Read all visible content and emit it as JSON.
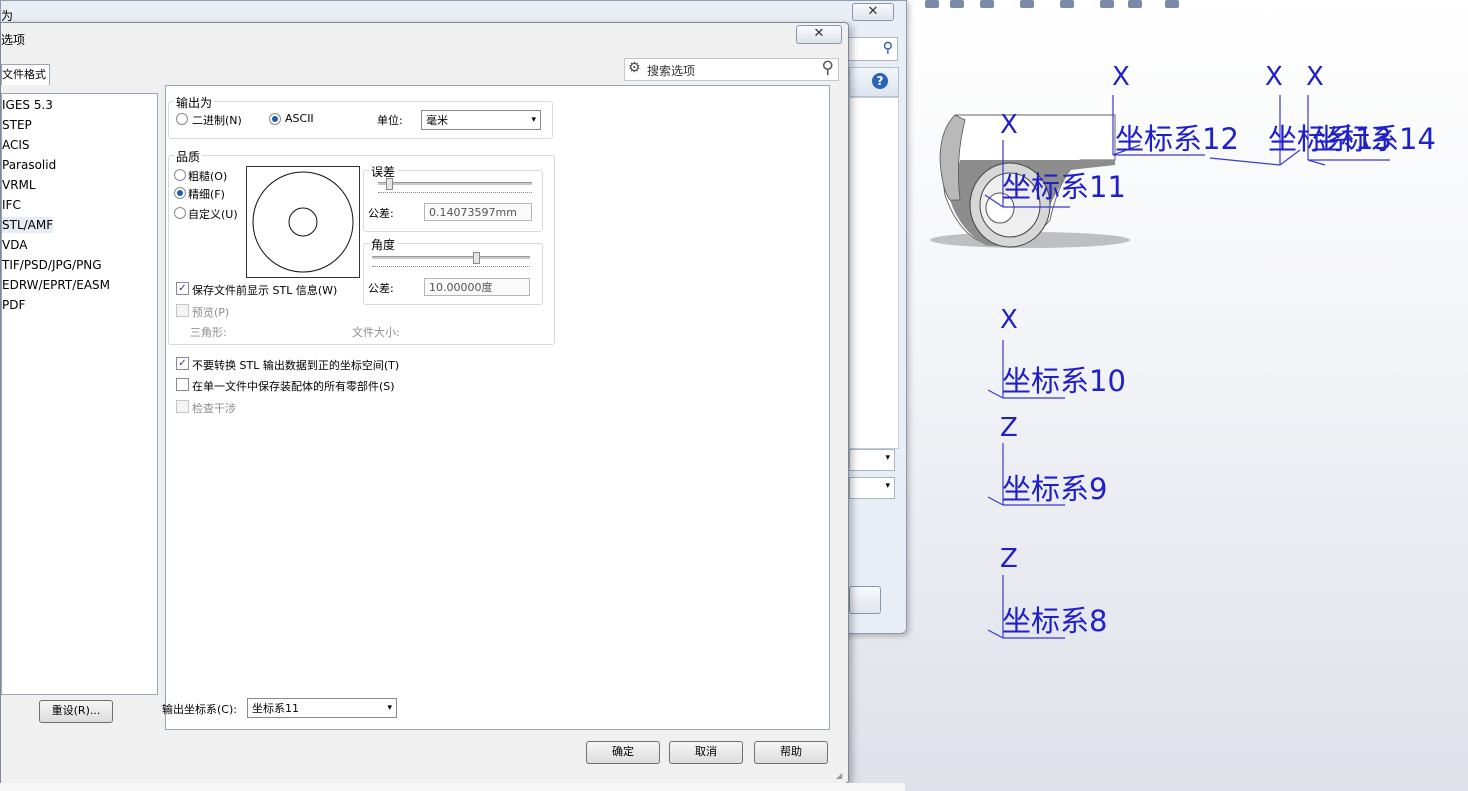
{
  "saveas_window": {
    "title": "为",
    "close_glyph": "✕",
    "search_glyph": "⚲",
    "help_glyph": "?",
    "combo_glyph": "▾"
  },
  "dialog": {
    "title": "选项",
    "close_glyph": "✕",
    "tab_label": "文件格式",
    "search_placeholder": "搜索选项",
    "search_glyph": "⚲",
    "gear_glyph": "⚙",
    "formats": [
      "IGES 5.3",
      "STEP",
      "ACIS",
      "Parasolid",
      "VRML",
      "IFC",
      "STL/AMF",
      "VDA",
      "TIF/PSD/JPG/PNG",
      "EDRW/EPRT/EASM",
      "PDF"
    ],
    "selected_format": "STL/AMF",
    "reset_label": "重设(R)...",
    "output_as": {
      "title": "输出为",
      "binary_label": "二进制(N)",
      "ascii_label": "ASCII",
      "selected": "ASCII",
      "unit_label": "单位:",
      "unit_value": "毫米"
    },
    "quality": {
      "title": "品质",
      "coarse_label": "粗糙(O)",
      "fine_label": "精细(F)",
      "custom_label": "自定义(U)",
      "selected": "精细(F)",
      "deviation_title": "误差",
      "deviation_tol_label": "公差:",
      "deviation_tol_value": "0.14073597mm",
      "angle_title": "角度",
      "angle_tol_label": "公差:",
      "angle_tol_value": "10.00000度",
      "show_info_label": "保存文件前显示 STL 信息(W)",
      "show_info_checked": true,
      "preview_label": "预览(P)",
      "preview_checked": false,
      "triangles_label": "三角形:",
      "filesize_label": "文件大小:"
    },
    "options": {
      "no_transform_label": "不要转换 STL 输出数据到正的坐标空间(T)",
      "no_transform_checked": true,
      "single_file_label": "在单一文件中保存装配体的所有零部件(S)",
      "single_file_checked": false,
      "interference_label": "检查干涉",
      "interference_checked": false
    },
    "output_cs_label": "输出坐标系(C):",
    "output_cs_value": "坐标系11",
    "check_glyph": "✓",
    "combo_glyph": "▾",
    "ok_label": "确定",
    "cancel_label": "取消",
    "help_label": "帮助"
  },
  "viewport": {
    "coordinate_systems": [
      {
        "name": "坐标系12",
        "axis_label": "X"
      },
      {
        "name": "坐标系13",
        "axis_label": "X"
      },
      {
        "name": "坐标系14",
        "axis_label": "X"
      },
      {
        "name": "坐标系11",
        "axis_label": "X"
      },
      {
        "name": "坐标系10",
        "axis_label": "X"
      },
      {
        "name": "坐标系9",
        "axis_label": "Z"
      },
      {
        "name": "坐标系8",
        "axis_label": "Z"
      }
    ],
    "axis_color": "#2020c8"
  }
}
